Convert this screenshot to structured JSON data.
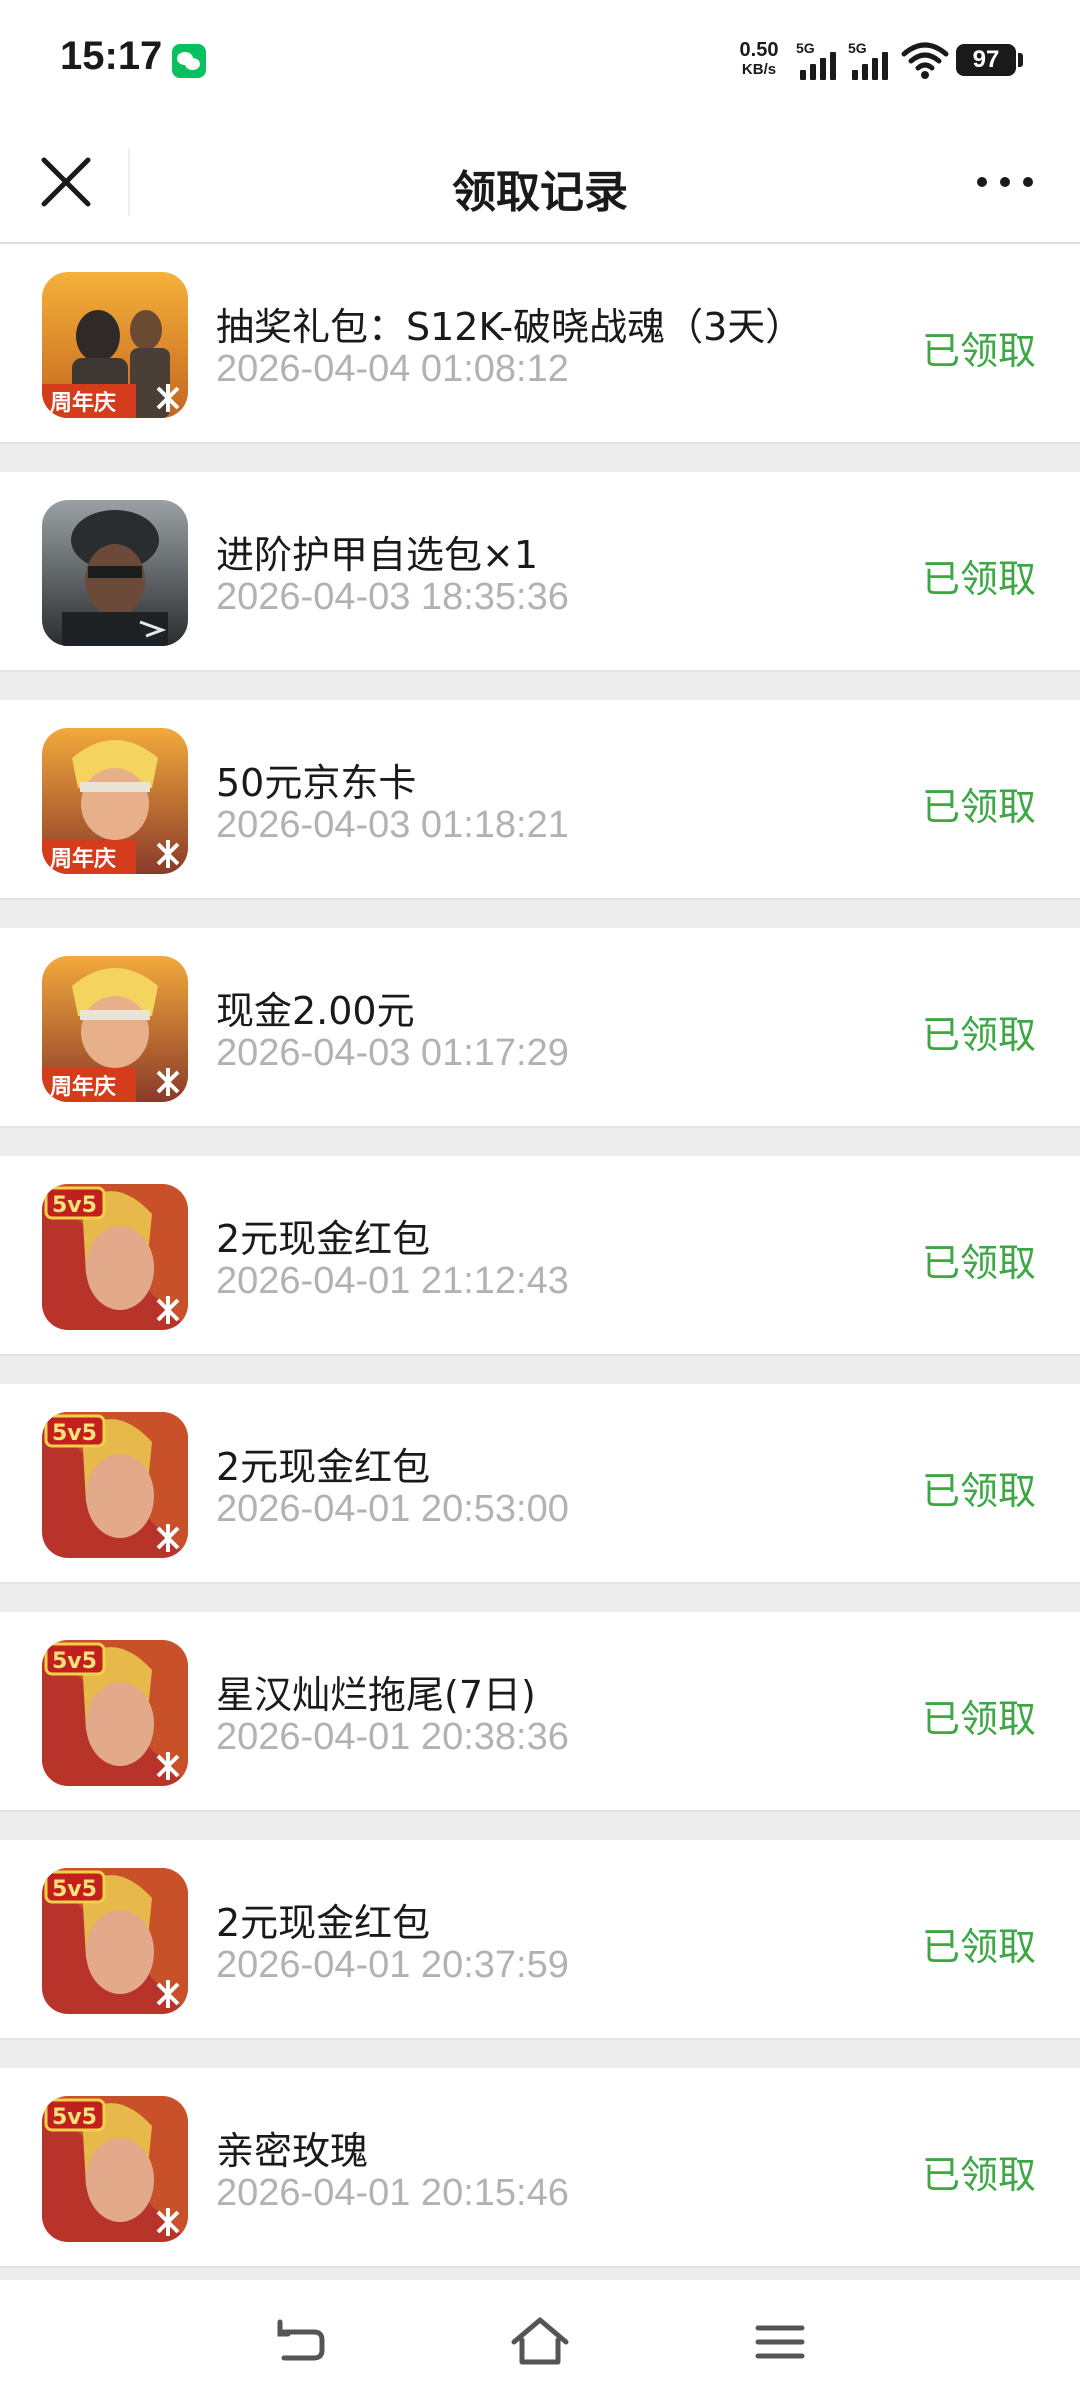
{
  "status_bar": {
    "time": "15:17",
    "net_speed_value": "0.50",
    "net_speed_unit": "KB/s",
    "signal_1_label": "5G",
    "signal_2_label": "5G",
    "battery": "97",
    "app_badge_icon": "wechat-icon"
  },
  "nav": {
    "title": "领取记录",
    "close_icon": "close-icon",
    "more_icon": "more-icon"
  },
  "records": [
    {
      "title": "抽奖礼包：S12K-破晓战魂（3天）",
      "time": "2026-04-04 01:08:12",
      "status": "已领取",
      "icon": "pubg-anniversary-game-icon"
    },
    {
      "title": "进阶护甲自选包×1",
      "time": "2026-04-03 18:35:36",
      "status": "已领取",
      "icon": "soldier-game-icon"
    },
    {
      "title": "50元京东卡",
      "time": "2026-04-03 01:18:21",
      "status": "已领取",
      "icon": "anniversary-game-icon"
    },
    {
      "title": "现金2.00元",
      "time": "2026-04-03 01:17:29",
      "status": "已领取",
      "icon": "anniversary-game-icon"
    },
    {
      "title": "2元现金红包",
      "time": "2026-04-01 21:12:43",
      "status": "已领取",
      "icon": "honor-of-kings-game-icon"
    },
    {
      "title": "2元现金红包",
      "time": "2026-04-01 20:53:00",
      "status": "已领取",
      "icon": "honor-of-kings-game-icon"
    },
    {
      "title": "星汉灿烂拖尾(7日)",
      "time": "2026-04-01 20:38:36",
      "status": "已领取",
      "icon": "honor-of-kings-game-icon"
    },
    {
      "title": "2元现金红包",
      "time": "2026-04-01 20:37:59",
      "status": "已领取",
      "icon": "honor-of-kings-game-icon"
    },
    {
      "title": "亲密玫瑰",
      "time": "2026-04-01 20:15:46",
      "status": "已领取",
      "icon": "honor-of-kings-game-icon"
    }
  ],
  "bottom_bar": {
    "back_icon": "back-icon",
    "home_icon": "home-icon",
    "menu_icon": "menu-icon"
  },
  "icon_badge_text": {
    "anniversary": "周年庆",
    "honor": "5v5"
  }
}
